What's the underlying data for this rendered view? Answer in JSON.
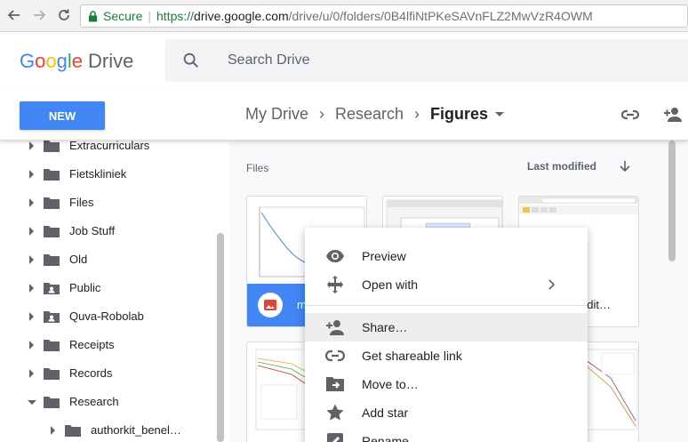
{
  "browser": {
    "secure_label": "Secure",
    "url_scheme": "https://",
    "url_host": "drive.google.com",
    "url_path": "/drive/u/0/folders/0B4lfiNtPKeSAVnFLZ2MwVzR4OWM"
  },
  "header": {
    "logo_letters": [
      "G",
      "o",
      "o",
      "g",
      "l",
      "e"
    ],
    "product": "Drive",
    "search_placeholder": "Search Drive"
  },
  "toolbar": {
    "new_label": "NEW",
    "breadcrumb": [
      "My Drive",
      "Research",
      "Figures"
    ],
    "sep": "›"
  },
  "sidebar": {
    "items": [
      {
        "label": "Extracurriculars",
        "type": "folder"
      },
      {
        "label": "Fietskliniek",
        "type": "folder"
      },
      {
        "label": "Files",
        "type": "folder"
      },
      {
        "label": "Job Stuff",
        "type": "folder"
      },
      {
        "label": "Old",
        "type": "folder"
      },
      {
        "label": "Public",
        "type": "shared-folder"
      },
      {
        "label": "Quva-Robolab",
        "type": "shared-folder"
      },
      {
        "label": "Receipts",
        "type": "folder"
      },
      {
        "label": "Records",
        "type": "folder"
      },
      {
        "label": "Research",
        "type": "folder",
        "expanded": true
      },
      {
        "label": "authorkit_benel…",
        "type": "folder",
        "child": true
      }
    ]
  },
  "main": {
    "section_label": "Files",
    "sort_label": "Last modified",
    "cards": [
      {
        "name": "m",
        "selected": true
      },
      {
        "name": "",
        "selected": false
      },
      {
        "name": "ckedit…",
        "selected": false
      }
    ]
  },
  "context_menu": {
    "items": [
      {
        "label": "Preview",
        "icon": "eye-icon"
      },
      {
        "label": "Open with",
        "icon": "move-arrows-icon",
        "submenu": true
      },
      {
        "label": "Share…",
        "icon": "person-add-icon",
        "hover": true
      },
      {
        "label": "Get shareable link",
        "icon": "link-icon"
      },
      {
        "label": "Move to…",
        "icon": "folder-move-icon"
      },
      {
        "label": "Add star",
        "icon": "star-icon"
      },
      {
        "label": "Rename",
        "icon": "pencil-icon"
      }
    ]
  },
  "colors": {
    "accent": "#4285f4",
    "secure_green": "#188038",
    "icon_grey": "#5f6368",
    "hover_bg": "#eeeeee"
  }
}
